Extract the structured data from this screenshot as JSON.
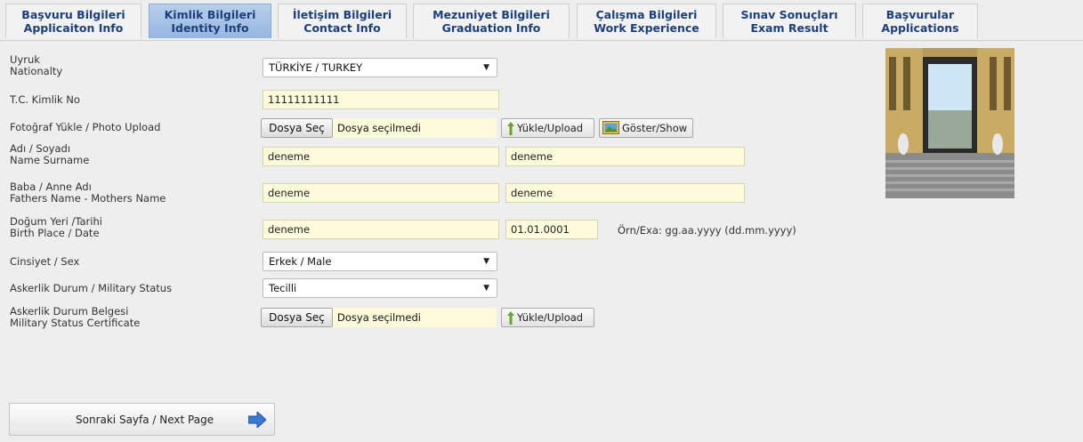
{
  "tabs": [
    {
      "line1": "Başvuru Bilgileri",
      "line2": "Applicaiton Info",
      "active": false
    },
    {
      "line1": "Kimlik Bilgileri",
      "line2": "Identity Info",
      "active": true
    },
    {
      "line1": "İletişim Bilgileri",
      "line2": "Contact Info",
      "active": false
    },
    {
      "line1": "Mezuniyet Bilgileri",
      "line2": "Graduation Info",
      "active": false
    },
    {
      "line1": "Çalışma Bilgileri",
      "line2": "Work Experience",
      "active": false
    },
    {
      "line1": "Sınav Sonuçları",
      "line2": "Exam Result",
      "active": false
    },
    {
      "line1": "Başvurular",
      "line2": "Applications",
      "active": false
    }
  ],
  "form": {
    "nationality": {
      "label_tr": "Uyruk",
      "label_en": "Nationalty",
      "value": "TÜRKİYE / TURKEY"
    },
    "tc_no": {
      "label": "T.C. Kimlik No",
      "value": "11111111111"
    },
    "photo": {
      "label": "Fotoğraf Yükle / Photo Upload",
      "choose": "Dosya Seç",
      "status": "Dosya seçilmedi",
      "upload": "Yükle/Upload",
      "show": "Göster/Show"
    },
    "name": {
      "label_tr": "Adı / Soyadı",
      "label_en": "Name Surname",
      "first": "deneme",
      "last": "deneme"
    },
    "parents": {
      "label_tr": "Baba / Anne Adı",
      "label_en": "Fathers Name - Mothers Name",
      "father": "deneme",
      "mother": "deneme"
    },
    "birth": {
      "label_tr": "Doğum Yeri /Tarihi",
      "label_en": "Birth Place / Date",
      "place": "deneme",
      "date": "01.01.0001",
      "hint": "Örn/Exa: gg.aa.yyyy (dd.mm.yyyy)"
    },
    "sex": {
      "label": "Cinsiyet / Sex",
      "value": "Erkek / Male"
    },
    "military": {
      "label": "Askerlik Durum / Military Status",
      "value": "Tecilli"
    },
    "military_doc": {
      "label_tr": "Askerlik Durum Belgesi",
      "label_en": "Military Status Certificate",
      "choose": "Dosya Seç",
      "status": "Dosya seçilmedi",
      "upload": "Yükle/Upload"
    }
  },
  "next_button": {
    "label": "Sonraki Sayfa / Next Page"
  },
  "colors": {
    "accent": "#1b3f79",
    "field_bg": "#fdfbdc",
    "active_tab": "#a7c3e6"
  }
}
